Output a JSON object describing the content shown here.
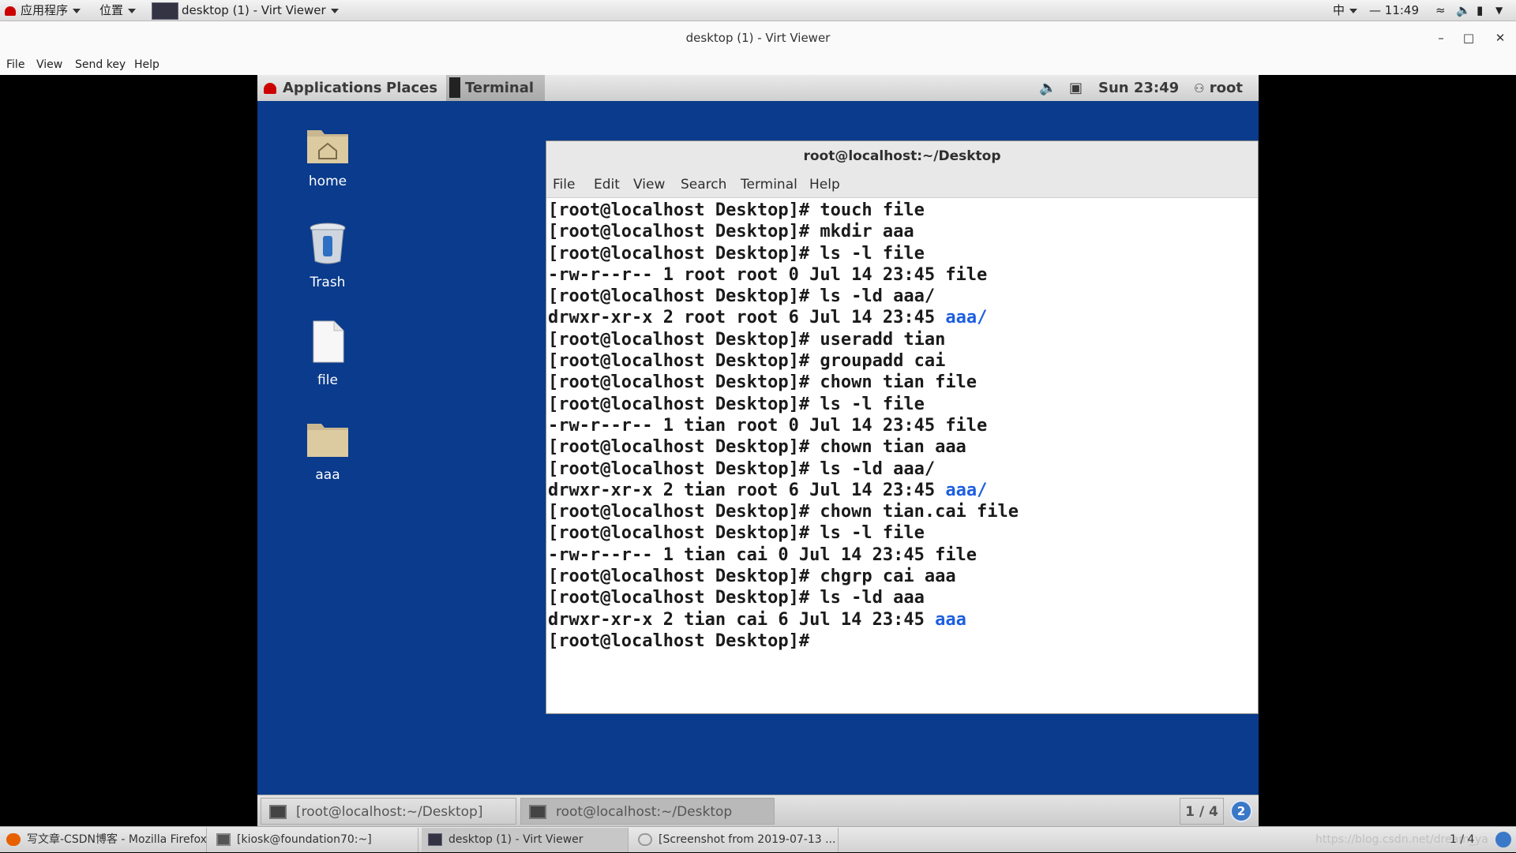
{
  "host_panel": {
    "apps_menu": "应用程序",
    "places_menu": "位置",
    "window_button": "desktop (1) - Virt Viewer",
    "input_method": "中",
    "clock": "11:49"
  },
  "viewer": {
    "title": "desktop (1) - Virt Viewer",
    "menu": [
      "File",
      "View",
      "Send key",
      "Help"
    ]
  },
  "guest_panel": {
    "applications": "Applications",
    "places": "Places",
    "terminal": "Terminal",
    "clock": "Sun 23:49",
    "user": "root"
  },
  "desktop_icons": [
    {
      "label": "home",
      "icon": "home-folder-icon"
    },
    {
      "label": "Trash",
      "icon": "trash-icon"
    },
    {
      "label": "file",
      "icon": "file-icon"
    },
    {
      "label": "aaa",
      "icon": "folder-icon"
    }
  ],
  "terminal": {
    "title": "root@localhost:~/Desktop",
    "menu": [
      "File",
      "Edit",
      "View",
      "Search",
      "Terminal",
      "Help"
    ],
    "lines": [
      {
        "text": "[root@localhost Desktop]# touch file",
        "dir": ""
      },
      {
        "text": "[root@localhost Desktop]# mkdir aaa",
        "dir": ""
      },
      {
        "text": "[root@localhost Desktop]# ls -l file",
        "dir": ""
      },
      {
        "text": "-rw-r--r-- 1 root root 0 Jul 14 23:45 file",
        "dir": ""
      },
      {
        "text": "[root@localhost Desktop]# ls -ld aaa/",
        "dir": ""
      },
      {
        "text": "drwxr-xr-x 2 root root 6 Jul 14 23:45 ",
        "dir": "aaa/"
      },
      {
        "text": "[root@localhost Desktop]# useradd tian",
        "dir": ""
      },
      {
        "text": "[root@localhost Desktop]# groupadd cai",
        "dir": ""
      },
      {
        "text": "[root@localhost Desktop]# chown tian file",
        "dir": ""
      },
      {
        "text": "[root@localhost Desktop]# ls -l file",
        "dir": ""
      },
      {
        "text": "-rw-r--r-- 1 tian root 0 Jul 14 23:45 file",
        "dir": ""
      },
      {
        "text": "[root@localhost Desktop]# chown tian aaa",
        "dir": ""
      },
      {
        "text": "[root@localhost Desktop]# ls -ld aaa/",
        "dir": ""
      },
      {
        "text": "drwxr-xr-x 2 tian root 6 Jul 14 23:45 ",
        "dir": "aaa/"
      },
      {
        "text": "[root@localhost Desktop]# chown tian.cai file",
        "dir": ""
      },
      {
        "text": "[root@localhost Desktop]# ls -l file",
        "dir": ""
      },
      {
        "text": "-rw-r--r-- 1 tian cai 0 Jul 14 23:45 file",
        "dir": ""
      },
      {
        "text": "[root@localhost Desktop]# chgrp cai aaa",
        "dir": ""
      },
      {
        "text": "[root@localhost Desktop]# ls -ld aaa",
        "dir": ""
      },
      {
        "text": "drwxr-xr-x 2 tian cai 6 Jul 14 23:45 ",
        "dir": "aaa"
      },
      {
        "text": "[root@localhost Desktop]#",
        "dir": ""
      }
    ]
  },
  "guest_taskbar": {
    "tasks": [
      "[root@localhost:~/Desktop]",
      "root@localhost:~/Desktop"
    ],
    "workspace": "1 / 4",
    "notification_count": "2"
  },
  "host_taskbar": {
    "tasks": [
      "写文章-CSDN博客 - Mozilla Firefox",
      "[kiosk@foundation70:~]",
      "desktop (1) - Virt Viewer",
      "[Screenshot from 2019-07-13 ..."
    ],
    "workspace": "1 / 4",
    "watermark": "https://blog.csdn.net/dream_ya"
  },
  "colors": {
    "guest_background": "#0a3b8c",
    "directory_text": "#1d5fe0"
  }
}
